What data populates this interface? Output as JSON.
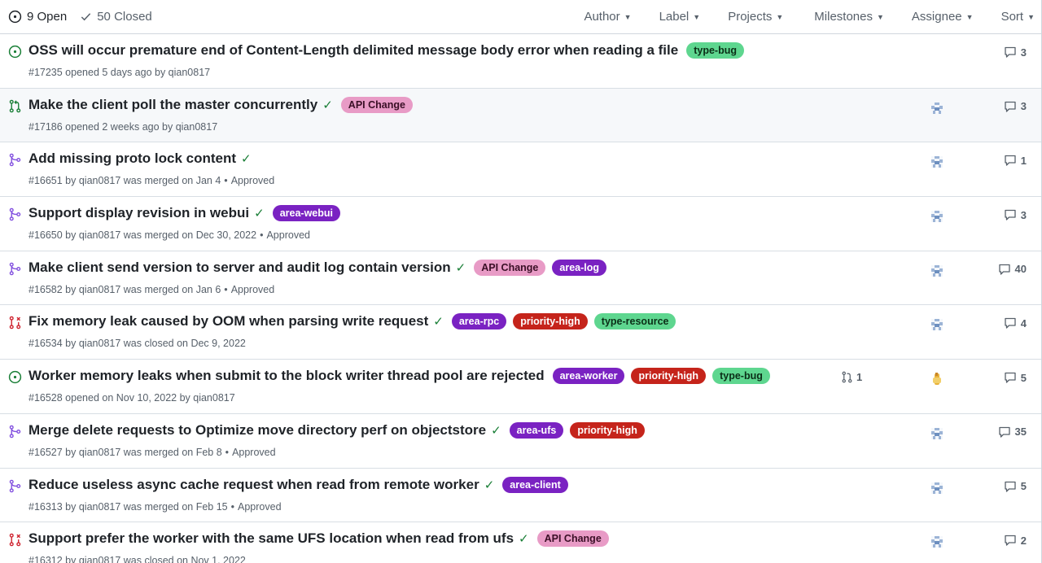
{
  "toolbar": {
    "open_label": "9 Open",
    "closed_label": "50 Closed",
    "filters": [
      {
        "label": "Author"
      },
      {
        "label": "Label"
      },
      {
        "label": "Projects"
      },
      {
        "label": "Milestones"
      },
      {
        "label": "Assignee"
      },
      {
        "label": "Sort"
      }
    ]
  },
  "colors": {
    "open": "#1a7f37",
    "merged": "#8250df",
    "closed": "#cf222e",
    "check": "#1a7f37"
  },
  "labels": {
    "type-bug": {
      "bg": "#5ed68f",
      "fg": "#0b2e17"
    },
    "api-change": {
      "bg": "#e89bc6",
      "fg": "#3a0f26"
    },
    "area-webui": {
      "bg": "#7a22c2",
      "fg": "#ffffff"
    },
    "area-log": {
      "bg": "#7a22c2",
      "fg": "#ffffff"
    },
    "area-rpc": {
      "bg": "#7a22c2",
      "fg": "#ffffff"
    },
    "priority-high": {
      "bg": "#c5241b",
      "fg": "#ffffff"
    },
    "type-resource": {
      "bg": "#5ed68f",
      "fg": "#0b2e17"
    },
    "area-worker": {
      "bg": "#7a22c2",
      "fg": "#ffffff"
    },
    "area-ufs": {
      "bg": "#7a22c2",
      "fg": "#ffffff"
    },
    "area-client": {
      "bg": "#7a22c2",
      "fg": "#ffffff"
    }
  },
  "rows": [
    {
      "state": "open-issue",
      "title": "OSS will occur premature end of Content-Length delimited message body error when reading a file",
      "check": false,
      "labels": [
        {
          "key": "type-bug",
          "text": "type-bug"
        }
      ],
      "meta": "#17235 opened 5 days ago by qian0817",
      "approved": "",
      "avatar": false,
      "linked": "",
      "comments": "3",
      "hover": false
    },
    {
      "state": "open-pr",
      "title": "Make the client poll the master concurrently",
      "check": true,
      "labels": [
        {
          "key": "api-change",
          "text": "API Change"
        }
      ],
      "meta": "#17186 opened 2 weeks ago by qian0817",
      "approved": "",
      "avatar": true,
      "linked": "",
      "comments": "3",
      "hover": true
    },
    {
      "state": "merged",
      "title": "Add missing proto lock content",
      "check": true,
      "labels": [],
      "meta": "#16651 by qian0817 was merged on Jan 4",
      "approved": "Approved",
      "avatar": true,
      "linked": "",
      "comments": "1",
      "hover": false
    },
    {
      "state": "merged",
      "title": "Support display revision in webui",
      "check": true,
      "labels": [
        {
          "key": "area-webui",
          "text": "area-webui"
        }
      ],
      "meta": "#16650 by qian0817 was merged on Dec 30, 2022",
      "approved": "Approved",
      "avatar": true,
      "linked": "",
      "comments": "3",
      "hover": false
    },
    {
      "state": "merged",
      "title": "Make client send version to server and audit log contain version",
      "check": true,
      "labels": [
        {
          "key": "api-change",
          "text": "API Change"
        },
        {
          "key": "area-log",
          "text": "area-log"
        }
      ],
      "meta": "#16582 by qian0817 was merged on Jan 6",
      "approved": "Approved",
      "avatar": true,
      "linked": "",
      "comments": "40",
      "hover": false
    },
    {
      "state": "closed-pr",
      "title": "Fix memory leak caused by OOM when parsing write request",
      "check": true,
      "labels": [
        {
          "key": "area-rpc",
          "text": "area-rpc"
        },
        {
          "key": "priority-high",
          "text": "priority-high"
        },
        {
          "key": "type-resource",
          "text": "type-resource"
        }
      ],
      "meta": "#16534 by qian0817 was closed on Dec 9, 2022",
      "approved": "",
      "avatar": true,
      "linked": "",
      "comments": "4",
      "hover": false
    },
    {
      "state": "open-issue",
      "title": "Worker memory leaks when submit to the block writer thread pool are rejected",
      "check": false,
      "labels": [
        {
          "key": "area-worker",
          "text": "area-worker"
        },
        {
          "key": "priority-high",
          "text": "priority-high"
        },
        {
          "key": "type-bug",
          "text": "type-bug"
        }
      ],
      "meta": "#16528 opened on Nov 10, 2022 by qian0817",
      "approved": "",
      "avatar": true,
      "avatar_alt": true,
      "linked": "1",
      "comments": "5",
      "hover": false
    },
    {
      "state": "merged",
      "title": "Merge delete requests to Optimize move directory perf on objectstore",
      "check": true,
      "labels": [
        {
          "key": "area-ufs",
          "text": "area-ufs"
        },
        {
          "key": "priority-high",
          "text": "priority-high"
        }
      ],
      "meta": "#16527 by qian0817 was merged on Feb 8",
      "approved": "Approved",
      "avatar": true,
      "linked": "",
      "comments": "35",
      "hover": false
    },
    {
      "state": "merged",
      "title": "Reduce useless async cache request when read from remote worker",
      "check": true,
      "labels": [
        {
          "key": "area-client",
          "text": "area-client"
        }
      ],
      "meta": "#16313 by qian0817 was merged on Feb 15",
      "approved": "Approved",
      "avatar": true,
      "linked": "",
      "comments": "5",
      "hover": false
    },
    {
      "state": "closed-pr",
      "title": "Support prefer the worker with the same UFS location when read from ufs",
      "check": true,
      "labels": [
        {
          "key": "api-change",
          "text": "API Change"
        }
      ],
      "meta": "#16312 by qian0817 was closed on Nov 1, 2022",
      "approved": "",
      "avatar": true,
      "linked": "",
      "comments": "2",
      "hover": false
    }
  ]
}
